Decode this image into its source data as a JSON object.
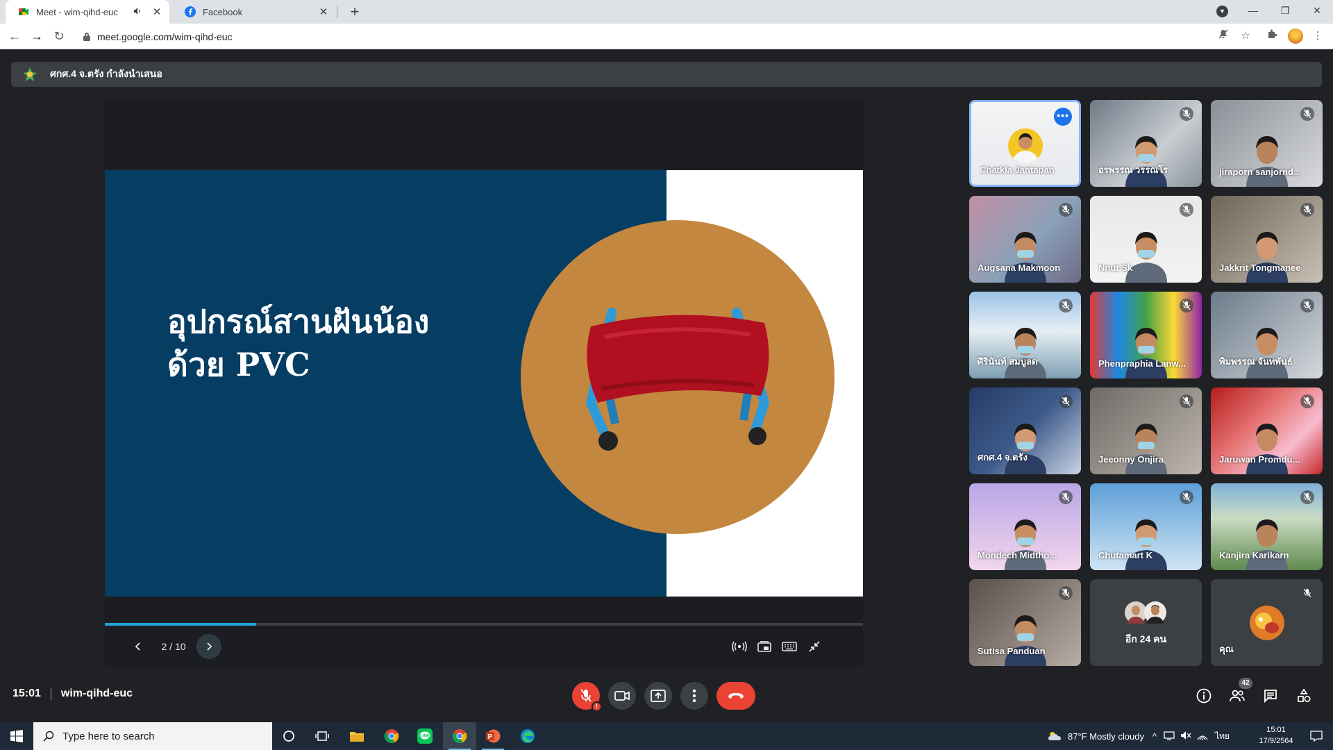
{
  "browser": {
    "tabs": [
      {
        "title": "Meet - wim-qihd-euc",
        "active": true
      },
      {
        "title": "Facebook",
        "active": false
      }
    ],
    "url": "meet.google.com/wim-qihd-euc"
  },
  "meet": {
    "presenter_banner": "ศกศ.4 จ.ตรัง กำลังนำเสนอ",
    "slide": {
      "title_line1": "อุปกรณ์สานฝันน้อง",
      "title_line2": "ด้วย PVC",
      "page_indicator": "2 / 10",
      "progress_fraction": 0.2
    },
    "participants": [
      {
        "name": "Chatkla Jantapan",
        "speaking": true
      },
      {
        "name": "อรพรรณ วรรณโร"
      },
      {
        "name": "jiraporn sanjornd..."
      },
      {
        "name": "Augsana Makmoon"
      },
      {
        "name": "Nnut Sk"
      },
      {
        "name": "Jakkrit Tongmanee"
      },
      {
        "name": "ศิรินันท์ สมบูลด"
      },
      {
        "name": "Phenpraphia Lanw..."
      },
      {
        "name": "พิมพรรณ จันทพันธ์"
      },
      {
        "name": "ศกศ.4 จ.ตรัง"
      },
      {
        "name": "Jeeonny Onjira"
      },
      {
        "name": "Jaruwan Promdu..."
      },
      {
        "name": "Mondech Midtho..."
      },
      {
        "name": "Chutamart K"
      },
      {
        "name": "Kanjira Karikarn"
      },
      {
        "name": "Sutisa Panduan"
      }
    ],
    "others_label": "อีก 24 คน",
    "self_label": "คุณ",
    "clock": "15:01",
    "meeting_code": "wim-qihd-euc",
    "participant_count": "42"
  },
  "taskbar": {
    "search_placeholder": "Type here to search",
    "weather": "87°F  Mostly cloudy",
    "language": "ไทย",
    "time": "15:01",
    "date": "17/9/2564"
  },
  "colors": {
    "meet_bg": "#202124",
    "tile_bg": "#3c4043",
    "speaking_border": "#8ab4f8",
    "end_call_red": "#ea4335",
    "slide_navy": "#063d63",
    "slide_circle": "#c4873f",
    "progress_blue": "#1fa3d6"
  }
}
